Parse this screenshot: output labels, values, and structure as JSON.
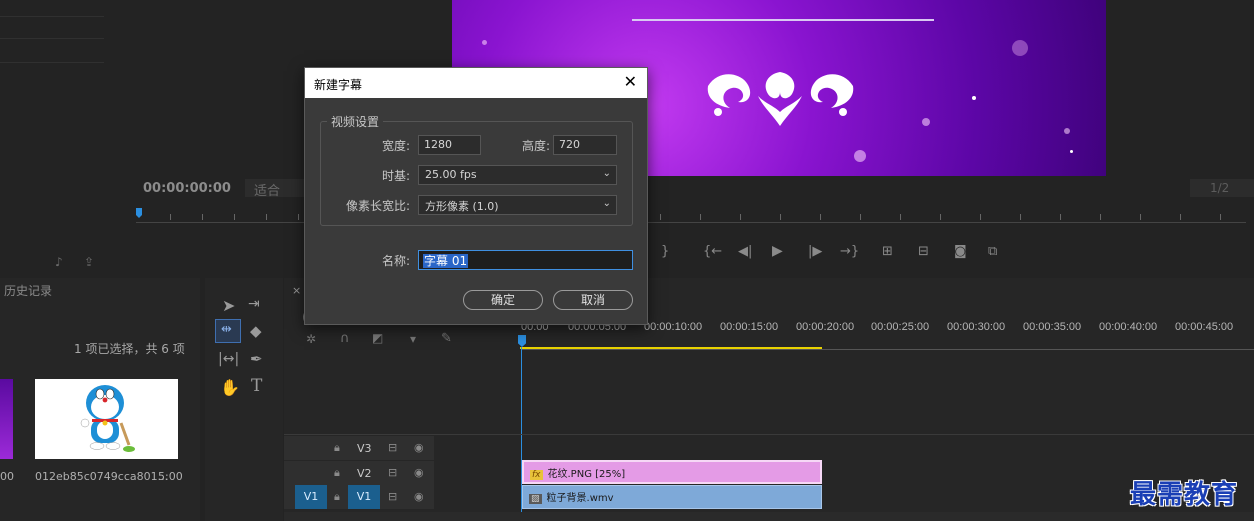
{
  "monitor": {
    "timecode": "00:00:00:00",
    "fit_label": "适合",
    "page_indicator": "1/2"
  },
  "history": {
    "tab_label": "历史记录",
    "selection_status": "1 项已选择，共 6 项",
    "thumb_left_time": "00",
    "thumb_right_name": "012eb85c0749cca801...",
    "thumb_right_duration": "5:00"
  },
  "dialog": {
    "title": "新建字幕",
    "group_label": "视频设置",
    "width_label": "宽度:",
    "width_value": "1280",
    "height_label": "高度:",
    "height_value": "720",
    "timebase_label": "时基:",
    "timebase_value": "25.00 fps",
    "pixel_aspect_label": "像素长宽比:",
    "pixel_aspect_value": "方形像素 (1.0)",
    "name_label": "名称:",
    "name_value": "字幕 01",
    "ok_label": "确定",
    "cancel_label": "取消"
  },
  "timeline": {
    "ruler": [
      "00:00",
      "00:00:05:00",
      "00:00:10:00",
      "00:00:15:00",
      "00:00:20:00",
      "00:00:25:00",
      "00:00:30:00",
      "00:00:35:00",
      "00:00:40:00",
      "00:00:45:00"
    ],
    "tracks": [
      {
        "label": "V3"
      },
      {
        "label": "V2"
      },
      {
        "label": "V1"
      }
    ],
    "source_patch": "V1",
    "clip_v2": "花纹.PNG [25%]",
    "clip_v1": "粒子背景.wmv",
    "fx_badge": "fx"
  },
  "watermark": "最需教育",
  "colors": {
    "accent_blue": "#2a66c8",
    "clip_pink": "#e49be6",
    "clip_blue": "#7ea9d8",
    "track_target": "#1b5f8e",
    "work_area": "#e8d200"
  }
}
